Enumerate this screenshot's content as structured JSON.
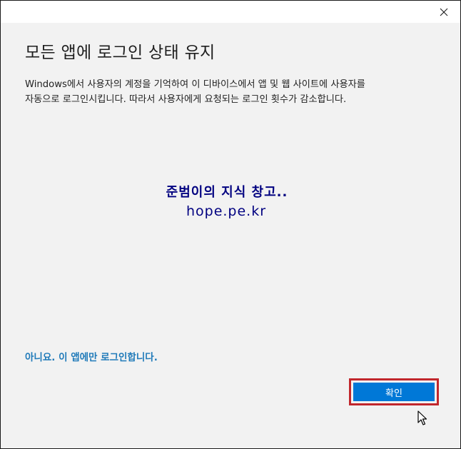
{
  "window": {
    "close_icon": "close-icon"
  },
  "dialog": {
    "title": "모든 앱에 로그인 상태 유지",
    "description_line1": "Windows에서 사용자의 계정을 기억하여 이 디바이스에서 앱 및 웹 사이트에 사용자를",
    "description_line2": "자동으로 로그인시킵니다. 따라서 사용자에게 요청되는 로그인 횟수가 감소합니다.",
    "no_link": "아니요. 이 앱에만 로그인합니다.",
    "ok_button": "확인"
  },
  "watermark": {
    "line1": "준범이의 지식 창고..",
    "line2": "hope.pe.kr"
  },
  "colors": {
    "accent": "#0078d7",
    "link": "#1f7ab9",
    "highlight": "#c1272d",
    "watermark": "#000080"
  }
}
